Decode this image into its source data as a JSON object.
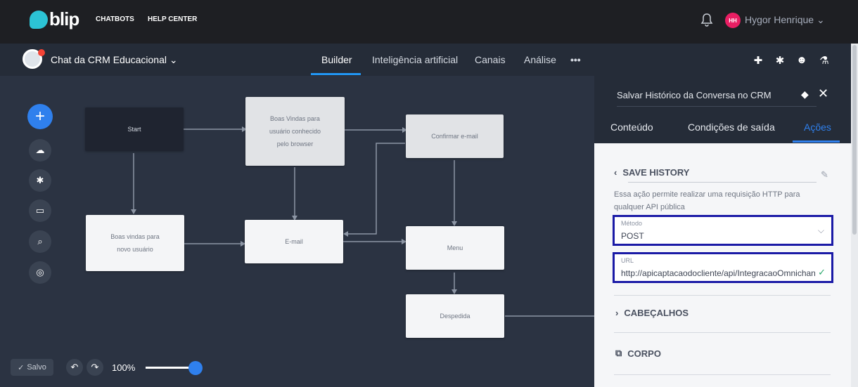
{
  "topbar": {
    "logo_text": "blip",
    "nav": [
      "CHATBOTS",
      "HELP CENTER"
    ],
    "avatar_initials": "HH",
    "user_name": "Hygor Henrique ⌄"
  },
  "botbar": {
    "bot_name": "Chat da CRM Educacional ⌄",
    "tabs": [
      "Builder",
      "Inteligência artificial",
      "Canais",
      "Análise",
      "•••"
    ],
    "active_tab": "Builder"
  },
  "flow": {
    "nodes": [
      {
        "label": "Start"
      },
      {
        "label": "Boas Vindas para usuário conhecido pelo browser"
      },
      {
        "label": "Confirmar e-mail"
      },
      {
        "label": "Boas vindas para novo usuário"
      },
      {
        "label": "E-mail"
      },
      {
        "label": "Menu"
      },
      {
        "label": "Despedida"
      }
    ]
  },
  "controls": {
    "saved_label": "Salvo",
    "zoom": "100%",
    "zoom_level": 1.0
  },
  "panel": {
    "title": "Salvar Histórico da Conversa no CRM",
    "tabs": [
      "Conteúdo",
      "Condições de saída",
      "Ações"
    ],
    "active_tab": "Ações",
    "section_title": "SAVE HISTORY",
    "description": "Essa ação permite realizar uma requisição HTTP para qualquer API pública",
    "method_label": "Método",
    "method_value": "POST",
    "url_label": "URL",
    "url_value": "http://apicaptacaodocliente/api/IntegracaoOmnichann",
    "headers_label": "CABEÇALHOS",
    "body_label": "CORPO"
  },
  "colors": {
    "accent": "#2f80ed",
    "highlight_border": "#1a1aa6",
    "brand": "#2cc3d5"
  },
  "icons": {
    "bell": "bell-icon",
    "puzzle": "puzzle-icon",
    "gear": "gear-icon",
    "users": "users-icon",
    "flask": "flask-icon"
  }
}
